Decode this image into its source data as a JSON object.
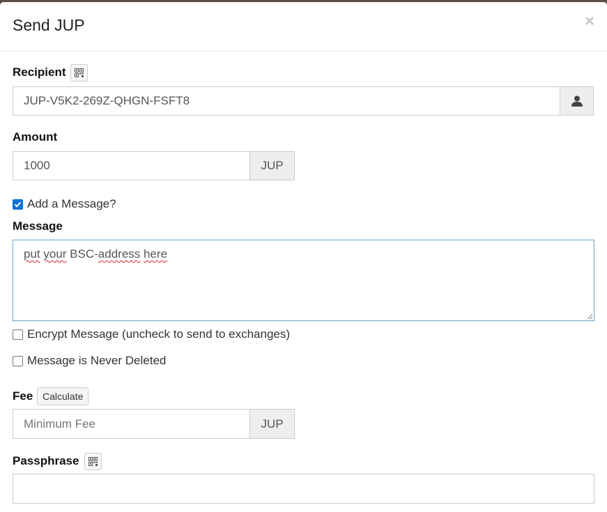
{
  "modal": {
    "title": "Send JUP",
    "close_symbol": "×"
  },
  "recipient": {
    "label": "Recipient",
    "value": "JUP-V5K2-269Z-QHGN-FSFT8"
  },
  "amount": {
    "label": "Amount",
    "value": "1000",
    "unit": "JUP"
  },
  "add_message": {
    "label": "Add a Message?",
    "checked": true
  },
  "message": {
    "label": "Message",
    "words": [
      "put",
      " ",
      "your",
      " BSC-",
      "address",
      " ",
      "here"
    ]
  },
  "encrypt_message": {
    "label": "Encrypt Message (uncheck to send to exchanges)",
    "checked": false
  },
  "never_deleted": {
    "label": "Message is Never Deleted",
    "checked": false
  },
  "fee": {
    "label": "Fee",
    "calculate_label": "Calculate",
    "placeholder": "Minimum Fee",
    "unit": "JUP"
  },
  "passphrase": {
    "label": "Passphrase",
    "value": ""
  },
  "icons": {
    "qr": "qr-code-icon",
    "contact": "user-icon",
    "check": "checkmark-icon"
  }
}
